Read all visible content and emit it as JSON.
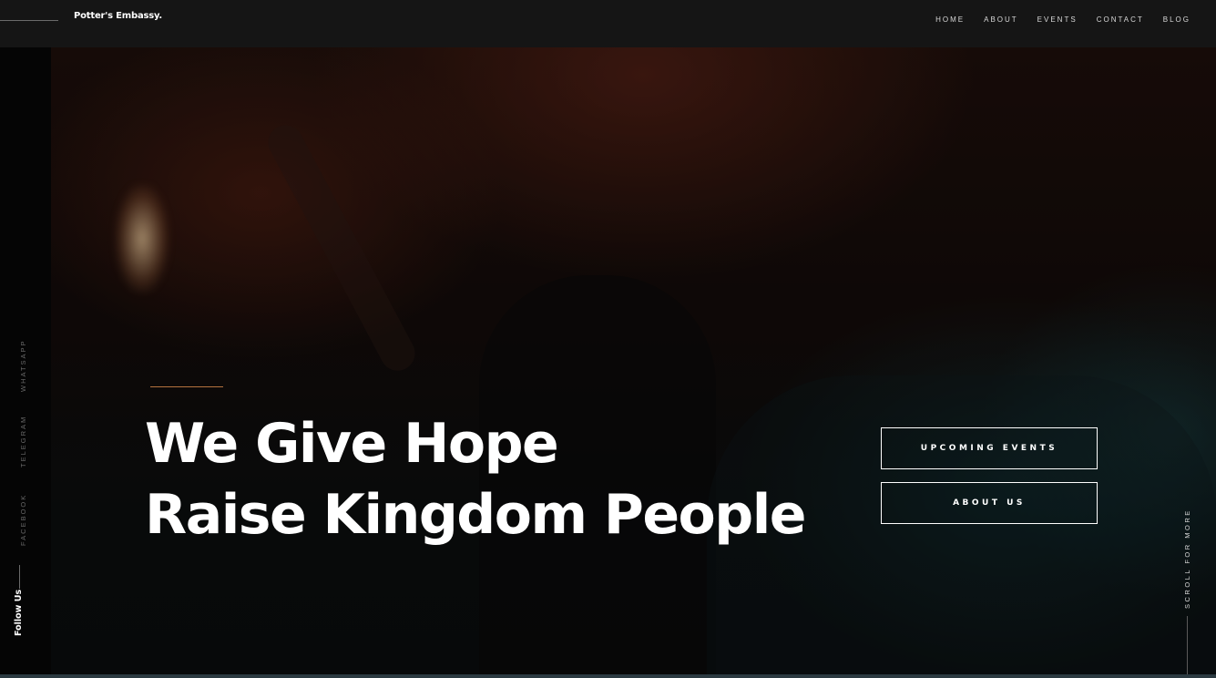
{
  "header": {
    "brand": "Potter's Embassy.",
    "nav": [
      {
        "label": "HOME"
      },
      {
        "label": "ABOUT"
      },
      {
        "label": "EVENTS"
      },
      {
        "label": "CONTACT"
      },
      {
        "label": "BLOG"
      }
    ]
  },
  "social": {
    "items": [
      {
        "label": "WHATSAPP",
        "icon": "whatsapp-icon"
      },
      {
        "label": "TELEGRAM",
        "icon": "telegram-icon"
      },
      {
        "label": "FACEBOOK",
        "icon": "facebook-icon"
      }
    ],
    "follow_label": "Follow Us"
  },
  "hero": {
    "headline_line1": "We Give Hope",
    "headline_line2": "Raise Kingdom People",
    "buttons": {
      "events": "UPCOMING EVENTS",
      "about": "ABOUT US"
    },
    "scroll_label": "SCROLL FOR MORE"
  },
  "colors": {
    "topbar_bg": "#151515",
    "accent_line": "#b5733f",
    "text": "#ffffff"
  }
}
